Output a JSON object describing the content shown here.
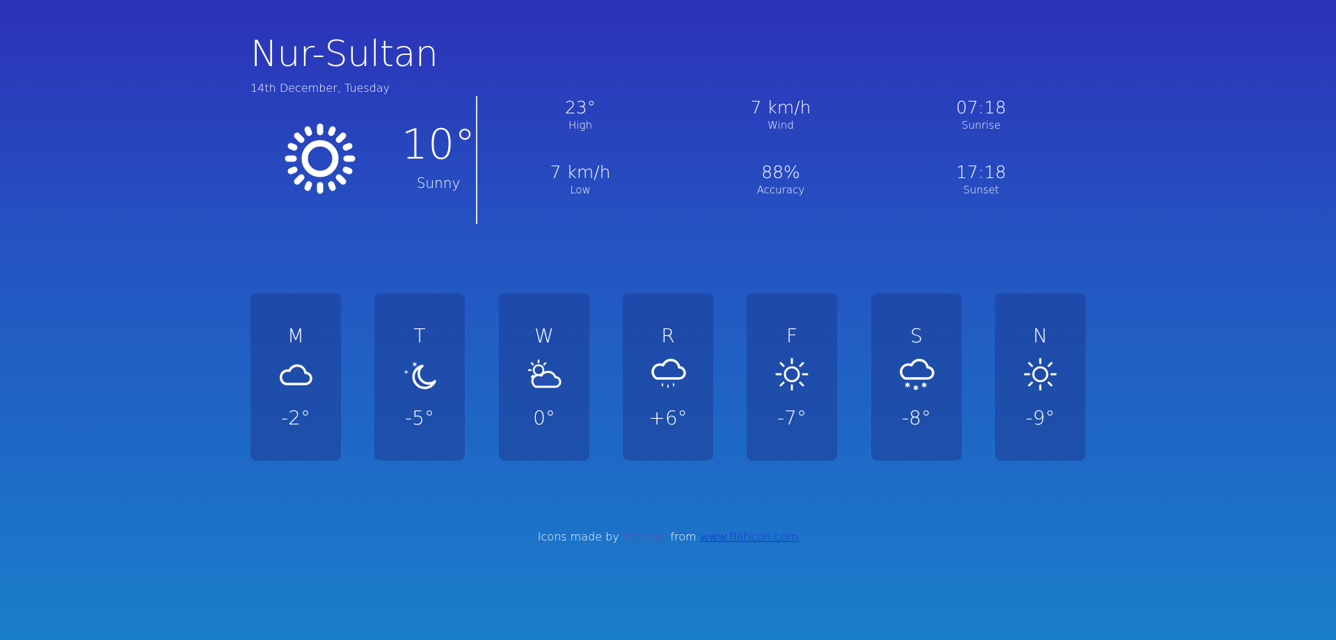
{
  "header": {
    "city": "Nur-Sultan",
    "date": "14th December, Tuesday"
  },
  "current": {
    "icon": "sun-icon",
    "temperature": "10°",
    "condition": "Sunny"
  },
  "stats": [
    {
      "value": "23°",
      "label": "High"
    },
    {
      "value": "7 km/h",
      "label": "Wind"
    },
    {
      "value": "07:18",
      "label": "Sunrise"
    },
    {
      "value": "7 km/h",
      "label": "Low"
    },
    {
      "value": "88%",
      "label": "Accuracy"
    },
    {
      "value": "17:18",
      "label": "Sunset"
    }
  ],
  "forecast": [
    {
      "day": "M",
      "icon": "cloud-icon",
      "temp": "-2°"
    },
    {
      "day": "T",
      "icon": "moon-stars-icon",
      "temp": "-5°"
    },
    {
      "day": "W",
      "icon": "partly-cloudy-icon",
      "temp": "0°"
    },
    {
      "day": "R",
      "icon": "rain-cloud-icon",
      "temp": "+6°"
    },
    {
      "day": "F",
      "icon": "sun-icon",
      "temp": "-7°"
    },
    {
      "day": "S",
      "icon": "snow-cloud-icon",
      "temp": "-8°"
    },
    {
      "day": "N",
      "icon": "sun-icon",
      "temp": "-9°"
    }
  ],
  "footer": {
    "prefix": "Icons made by",
    "author": "iconixar",
    "middle": "from",
    "site": "www.flaticon.com"
  },
  "colors": {
    "bg_top": "#2c32b8",
    "bg_bottom": "#1a7fcb",
    "card": "#1e3c96",
    "link": "#1a31d9"
  }
}
